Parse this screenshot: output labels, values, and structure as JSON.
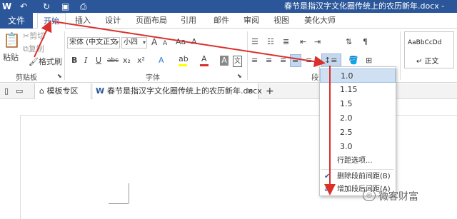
{
  "titlebar": {
    "app_icon": "W",
    "undo_icon": "undo-icon",
    "redo_icon": "redo-icon",
    "save_icon": "save-icon",
    "print_icon": "print-preview-icon",
    "doc_title": "春节是指汉字文化圈传统上的农历新年.docx -"
  },
  "tabs": {
    "file": "文件",
    "items": [
      "开始",
      "插入",
      "设计",
      "页面布局",
      "引用",
      "邮件",
      "审阅",
      "视图",
      "美化大师"
    ]
  },
  "clipboard": {
    "paste": "粘贴",
    "cut": "剪切",
    "copy": "复制",
    "format_painter": "格式刷",
    "group_label": "剪贴板"
  },
  "font": {
    "font_name": "宋体 (中文正文",
    "font_size": "小四",
    "grow": "A",
    "shrink": "A",
    "case": "Aa",
    "clear": "A",
    "bold": "B",
    "italic": "I",
    "underline": "U",
    "strike": "abc",
    "subscript": "x₂",
    "superscript": "x²",
    "effects": "A",
    "highlight": "ab",
    "color": "A",
    "shade": "A",
    "wen": "文",
    "group_label": "字体"
  },
  "paragraph": {
    "group_label": "段落",
    "active_control": "line-spacing"
  },
  "styles": {
    "sample": "AaBbCcDd",
    "name": "↵ 正文"
  },
  "docbar": {
    "template_tab": "模板专区",
    "doc_tab": "春节是指汉字文化圈传统上的农历新年.docx",
    "close": "×",
    "add": "+"
  },
  "line_spacing_menu": {
    "options": [
      "1.0",
      "1.15",
      "1.5",
      "2.0",
      "2.5",
      "3.0"
    ],
    "selected": "1.0",
    "more": "行距选项...",
    "remove_before": "删除段前间距(B)",
    "add_after": "增加段后间距(A)"
  },
  "watermark": {
    "icon": "wechat-icon",
    "text": "微客财富"
  },
  "colors": {
    "brand": "#2b579a",
    "arrow": "#d9302c",
    "highlight": "#cfe0f3",
    "font_color_bar": "#d9302c",
    "highlight_bar": "#ffff00"
  }
}
